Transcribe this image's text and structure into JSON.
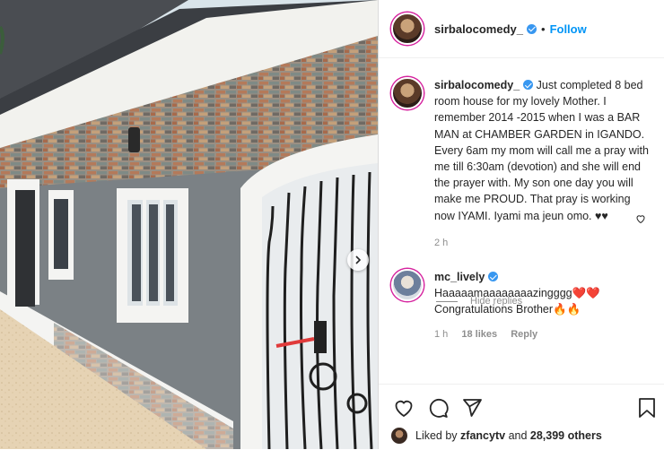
{
  "post": {
    "username": "sirbalocomedy_",
    "follow_label": "Follow",
    "caption": "Just completed 8 bed room house for my lovely Mother. I remember 2014 -2015 when I was a BAR MAN at CHAMBER GARDEN in IGANDO. Every 6am my mom will call me a pray with me till 6:30am (devotion) and she will end the prayer with. My son one day you will make me PROUD. That pray is working now IYAMI. Iyami ma jeun omo. ♥♥",
    "caption_time": "2 h"
  },
  "comment": {
    "username": "mc_lively",
    "text": "Haaaaamaaaaaaaazingggg",
    "text2": "Congratulations Brother",
    "time": "1 h",
    "likes": "18 likes",
    "reply_label": "Reply",
    "hide_replies": "Hide replies"
  },
  "likes_row": {
    "prefix": "Liked by",
    "user": "zfancytv",
    "middle": "and",
    "count": "28,399 others"
  },
  "icons": {
    "like": "heart-icon",
    "comment": "comment-icon",
    "share": "share-icon",
    "save": "bookmark-icon",
    "next": "chevron-right-icon",
    "verified": "verified-badge-icon"
  },
  "colors": {
    "link_blue": "#0095f6",
    "verified_blue": "#3897f0",
    "muted": "#8e8e8e"
  }
}
